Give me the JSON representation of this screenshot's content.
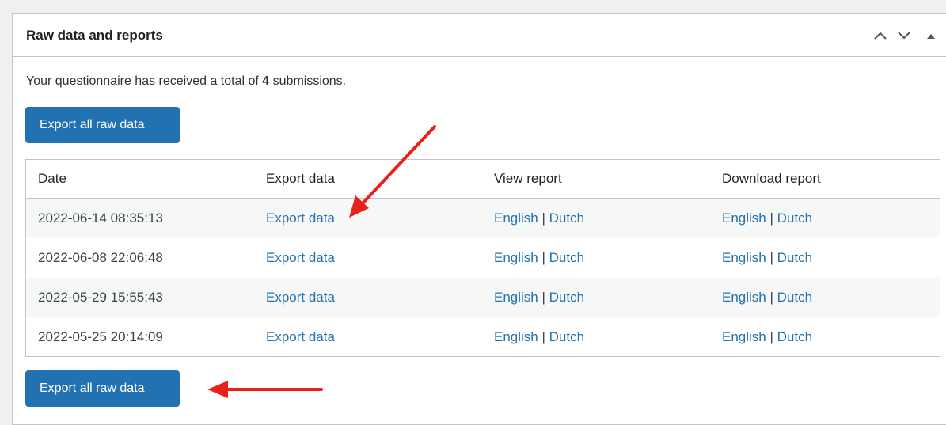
{
  "panel": {
    "title": "Raw data and reports",
    "controls": [
      "chevron-up-icon",
      "chevron-down-icon",
      "triangle-up-icon"
    ]
  },
  "summary": {
    "prefix": "Your questionnaire has received a total of",
    "count": "4",
    "suffix": "submissions."
  },
  "buttons": {
    "export_all_top": "Export all raw data",
    "export_all_bottom": "Export all raw data"
  },
  "table": {
    "headers": [
      "Date",
      "Export data",
      "View report",
      "Download report"
    ],
    "rows": [
      {
        "date": "2022-06-14 08:35:13",
        "export": "Export data",
        "view_en": "English",
        "view_nl": "Dutch",
        "dl_en": "English",
        "dl_nl": "Dutch",
        "sep": "|"
      },
      {
        "date": "2022-06-08 22:06:48",
        "export": "Export data",
        "view_en": "English",
        "view_nl": "Dutch",
        "dl_en": "English",
        "dl_nl": "Dutch",
        "sep": "|"
      },
      {
        "date": "2022-05-29 15:55:43",
        "export": "Export data",
        "view_en": "English",
        "view_nl": "Dutch",
        "dl_en": "English",
        "dl_nl": "Dutch",
        "sep": "|"
      },
      {
        "date": "2022-05-25 20:14:09",
        "export": "Export data",
        "view_en": "English",
        "view_nl": "Dutch",
        "dl_en": "English",
        "dl_nl": "Dutch",
        "sep": "|"
      }
    ]
  },
  "colors": {
    "accent": "#2271b1",
    "annotation_arrow": "#e8201a",
    "row_stripe": "#f6f7f7"
  }
}
